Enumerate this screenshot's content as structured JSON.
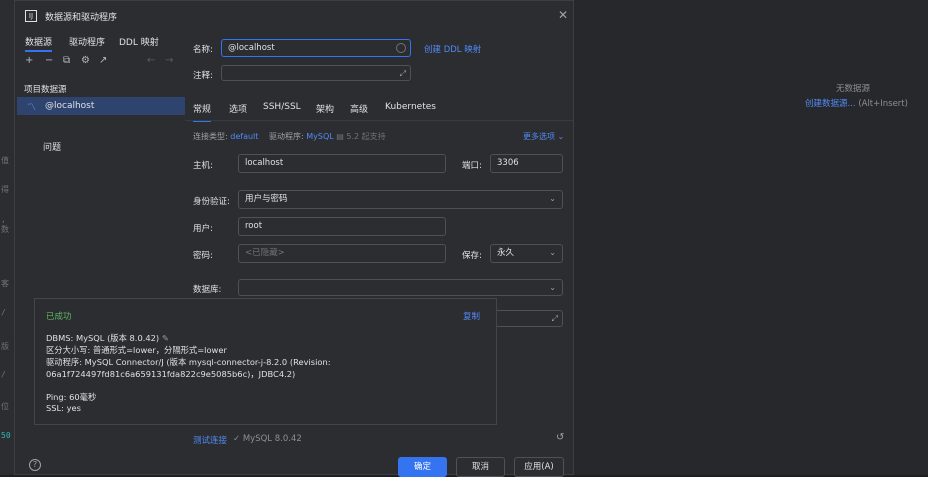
{
  "dialog": {
    "title": "数据源和驱动程序",
    "left_tabs": [
      "数据源",
      "驱动程序",
      "DDL 映射"
    ],
    "section_label": "项目数据源",
    "selected_item": "@localhost",
    "problems": "问题"
  },
  "form": {
    "name_label": "名称:",
    "name_value": "@localhost",
    "create_ddl_link": "创建 DDL 映射",
    "comment_label": "注释:",
    "subtabs": [
      "常规",
      "选项",
      "SSH/SSL",
      "架构",
      "高级",
      "Kubernetes"
    ],
    "conn_type_label": "连接类型:",
    "conn_type_value": "default",
    "driver_label": "驱动程序:",
    "driver_value": "MySQL",
    "driver_note": "5.2 起支持",
    "more_options": "更多选项",
    "host_label": "主机:",
    "host_value": "localhost",
    "port_label": "端口:",
    "port_value": "3306",
    "auth_label": "身份验证:",
    "auth_value": "用户与密码",
    "user_label": "用户:",
    "user_value": "root",
    "password_label": "密码:",
    "password_placeholder": "<已隐藏>",
    "save_label": "保存:",
    "save_value": "永久",
    "database_label": "数据库:"
  },
  "popup": {
    "status": "已成功",
    "copy": "复制",
    "lines": [
      "DBMS: MySQL (版本 8.0.42)",
      "区分大小写: 普通形式=lower，分隔形式=lower",
      "驱动程序: MySQL Connector/J (版本 mysql-connector-j-8.2.0 (Revision:",
      "06a1f724497fd81c6a659131fda822c9e5085b6c)，JDBC4.2)",
      "",
      "Ping: 60毫秒",
      "SSL: yes"
    ]
  },
  "bottom": {
    "test_link": "测试连接",
    "test_result": "MySQL 8.0.42",
    "help": "?",
    "ok": "确定",
    "cancel": "取消",
    "apply": "应用(A)"
  },
  "right_panel": {
    "no_data": "无数据源",
    "create_link": "创建数据源...",
    "shortcut": "(Alt+Insert)"
  },
  "editor_fragments": [
    "值",
    "得",
    ", 数",
    "客",
    "/",
    "版",
    "/",
    "位",
    "50"
  ],
  "colors": {
    "accent": "#3574f0",
    "success": "#5fb865",
    "link": "#548af7"
  }
}
